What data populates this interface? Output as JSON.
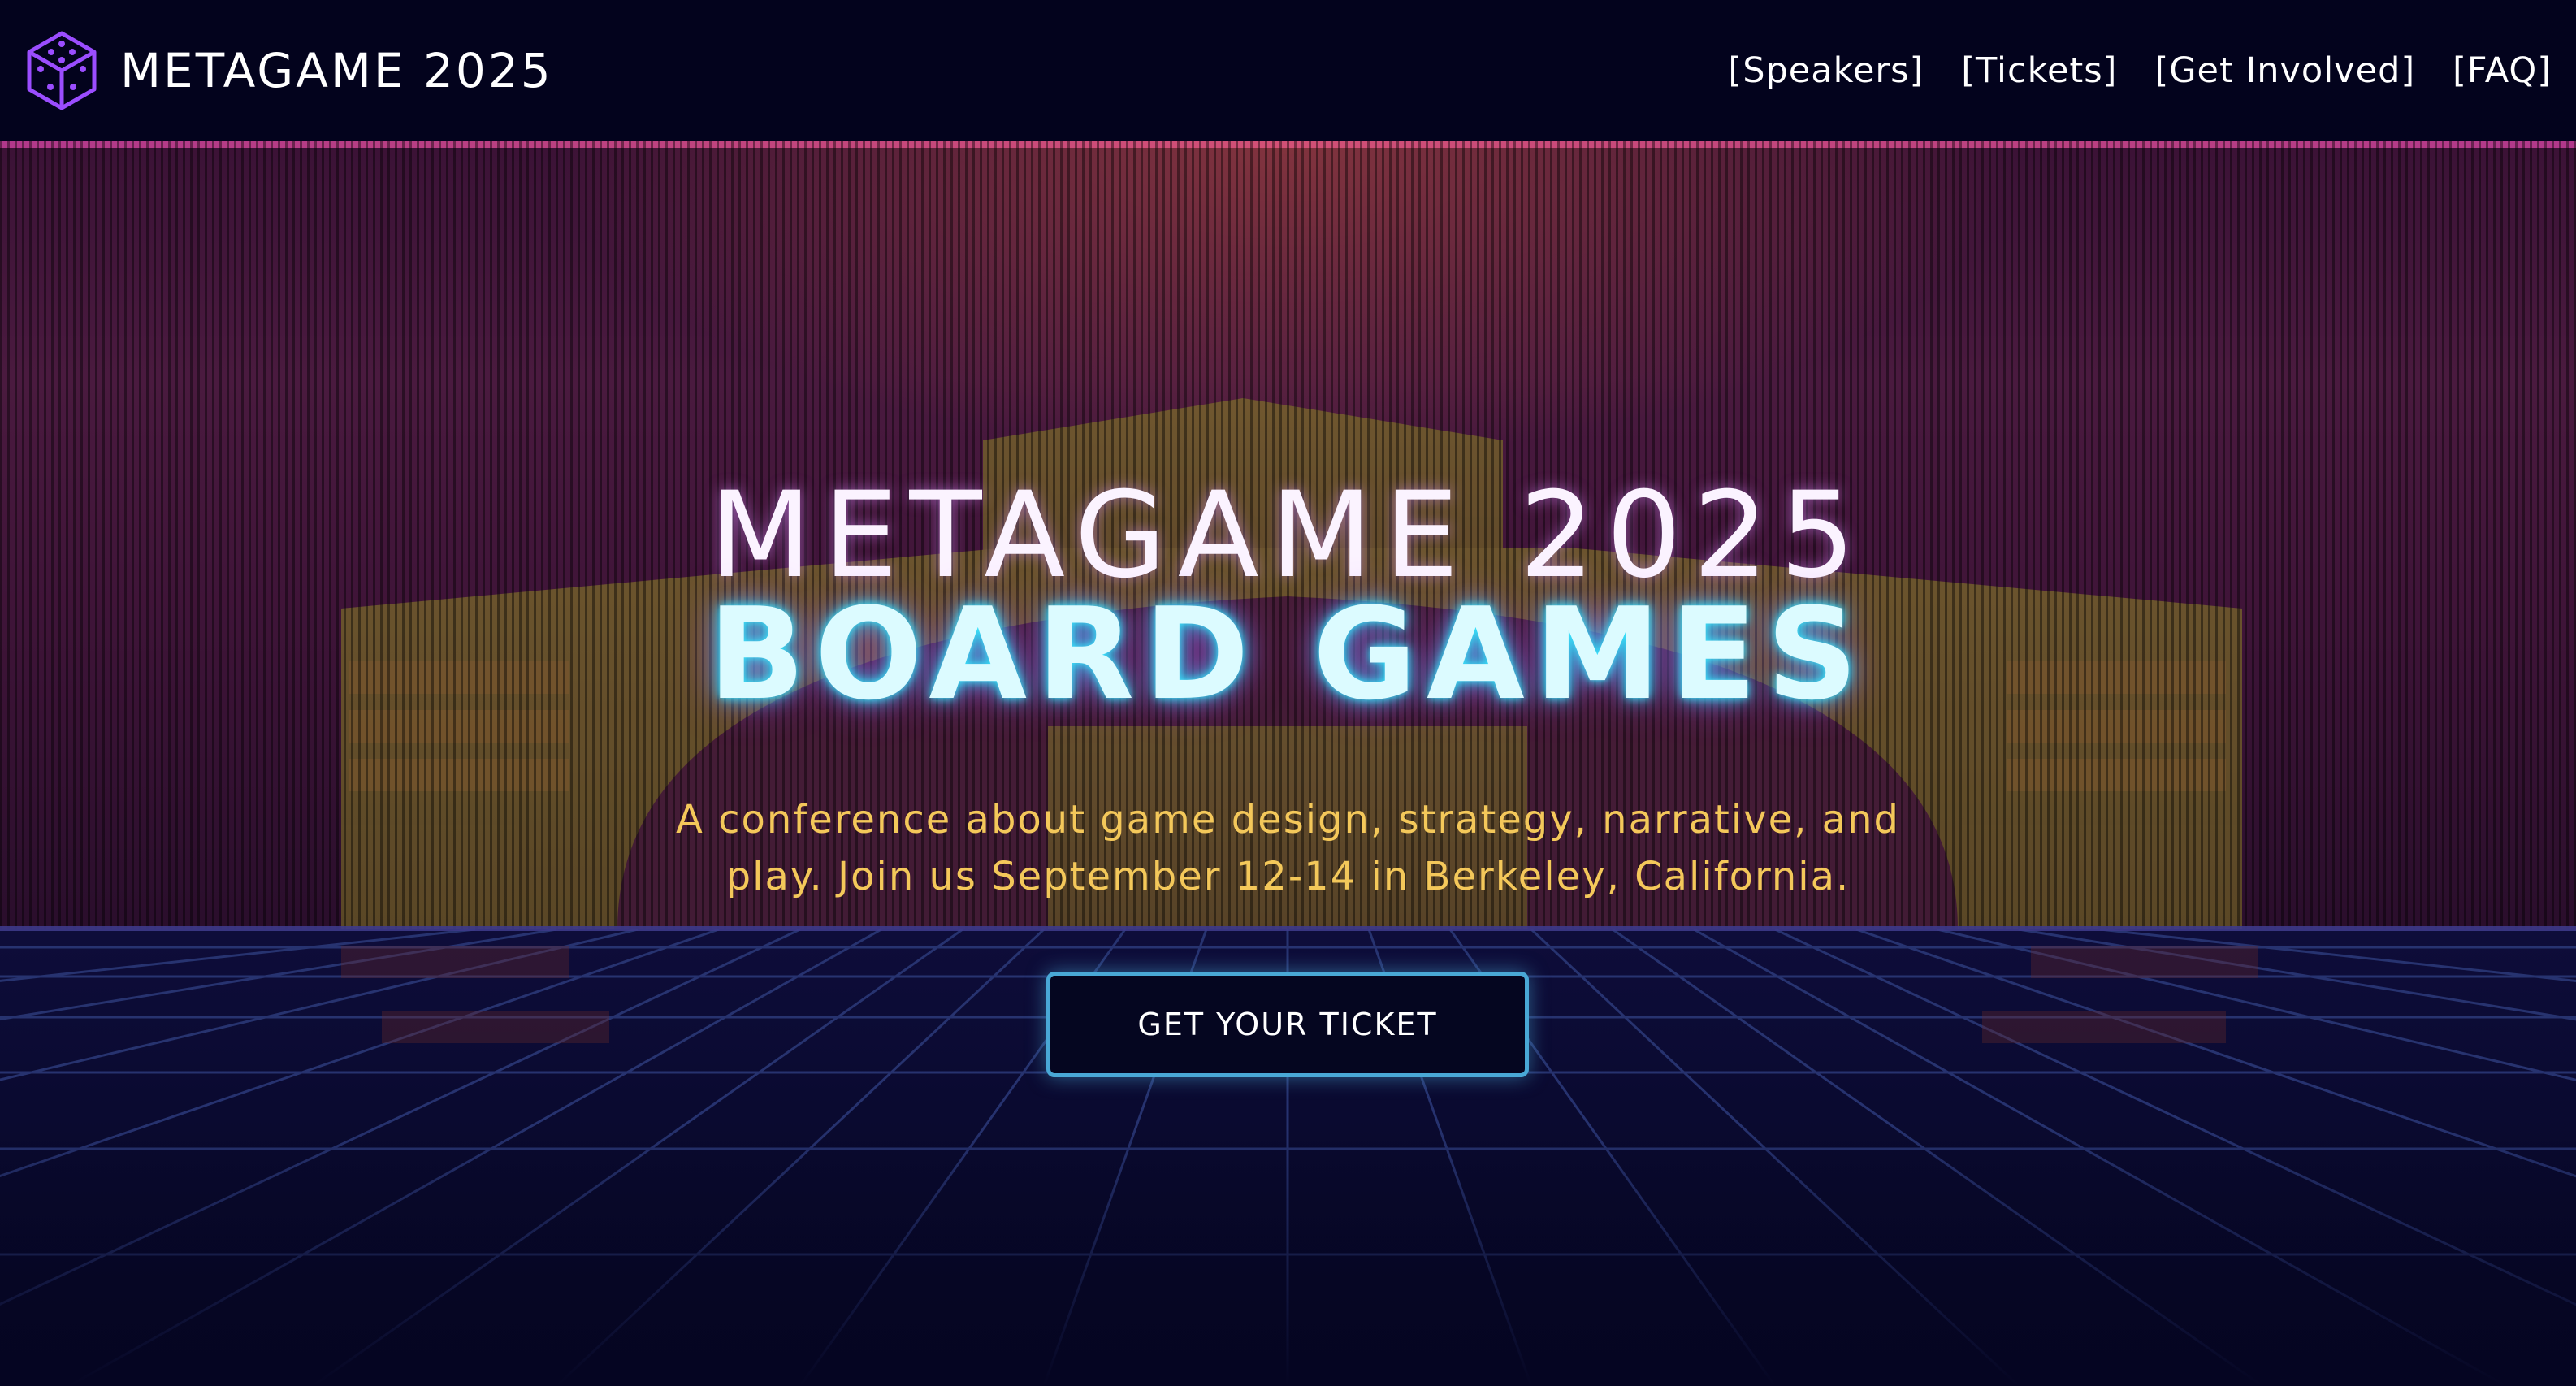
{
  "navbar": {
    "brand_title": "METAGAME 2025",
    "brand_icon": "dice-icon",
    "links": [
      {
        "label": "[Speakers]"
      },
      {
        "label": "[Tickets]"
      },
      {
        "label": "[Get Involved]"
      },
      {
        "label": "[FAQ]"
      }
    ]
  },
  "hero": {
    "title_line1": "METAGAME 2025",
    "title_line2": "BOARD GAMES",
    "subtitle": "A conference about game design, strategy, narrative, and play. Join us September 12-14 in Berkeley, California.",
    "cta_label": "GET YOUR TICKET"
  },
  "colors": {
    "background": "#050522",
    "nav_background": "#03031d",
    "title_glow": "#3be8ff",
    "subtitle": "#f4c85a",
    "cta_border": "#49a8d6",
    "dice_icon": "#9b4dff"
  }
}
